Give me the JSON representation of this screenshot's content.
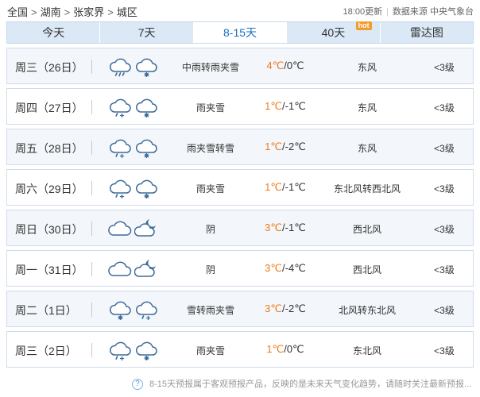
{
  "breadcrumb": [
    "全国",
    "湖南",
    "张家界",
    "城区"
  ],
  "breadcrumb_sep": ">",
  "update_time": "18:00更新",
  "data_source": "数据来源 中央气象台",
  "meta_divider": "|",
  "tabs": [
    {
      "label": "今天",
      "active": false
    },
    {
      "label": "7天",
      "active": false
    },
    {
      "label": "8-15天",
      "active": true
    },
    {
      "label": "40天",
      "active": false,
      "badge": "hot"
    },
    {
      "label": "雷达图",
      "active": false
    }
  ],
  "days": [
    {
      "date": "周三（26日）",
      "icons": [
        "rain-cloud-icon",
        "snow-cloud-icon"
      ],
      "weather": "中雨转雨夹雪",
      "high": "4℃",
      "low": "0℃",
      "wind": "东风",
      "level": "<3级"
    },
    {
      "date": "周四（27日）",
      "icons": [
        "sleet-cloud-icon",
        "snow-cloud-icon"
      ],
      "weather": "雨夹雪",
      "high": "1℃",
      "low": "-1℃",
      "wind": "东风",
      "level": "<3级"
    },
    {
      "date": "周五（28日）",
      "icons": [
        "sleet-cloud-icon",
        "snow-cloud-icon"
      ],
      "weather": "雨夹雪转雪",
      "high": "1℃",
      "low": "-2℃",
      "wind": "东风",
      "level": "<3级"
    },
    {
      "date": "周六（29日）",
      "icons": [
        "sleet-cloud-icon",
        "snow-cloud-icon"
      ],
      "weather": "雨夹雪",
      "high": "1℃",
      "low": "-1℃",
      "wind": "东北风转西北风",
      "level": "<3级"
    },
    {
      "date": "周日（30日）",
      "icons": [
        "overcast-cloud-icon",
        "cloudy-night-icon"
      ],
      "weather": "阴",
      "high": "3℃",
      "low": "-1℃",
      "wind": "西北风",
      "level": "<3级"
    },
    {
      "date": "周一（31日）",
      "icons": [
        "overcast-cloud-icon",
        "cloudy-night-icon"
      ],
      "weather": "阴",
      "high": "3℃",
      "low": "-4℃",
      "wind": "西北风",
      "level": "<3级"
    },
    {
      "date": "周二（1日）",
      "icons": [
        "snow-cloud-icon",
        "sleet-cloud-icon"
      ],
      "weather": "雪转雨夹雪",
      "high": "3℃",
      "low": "-2℃",
      "wind": "北风转东北风",
      "level": "<3级"
    },
    {
      "date": "周三（2日）",
      "icons": [
        "sleet-cloud-icon",
        "snow-cloud-icon"
      ],
      "weather": "雨夹雪",
      "high": "1℃",
      "low": "0℃",
      "wind": "东北风",
      "level": "<3级"
    }
  ],
  "temp_separator": "/",
  "note_icon": "?",
  "note": "8-15天预报属于客观预报产品，反映的是未来天气变化趋势，请随时关注最新预报...",
  "colors": {
    "accent": "#1a6ec2",
    "high_temp": "#f07a1a",
    "tab_bg": "#dbe8f6",
    "hot_badge": "#f39c2b",
    "icon_stroke": "#3d6b99"
  }
}
